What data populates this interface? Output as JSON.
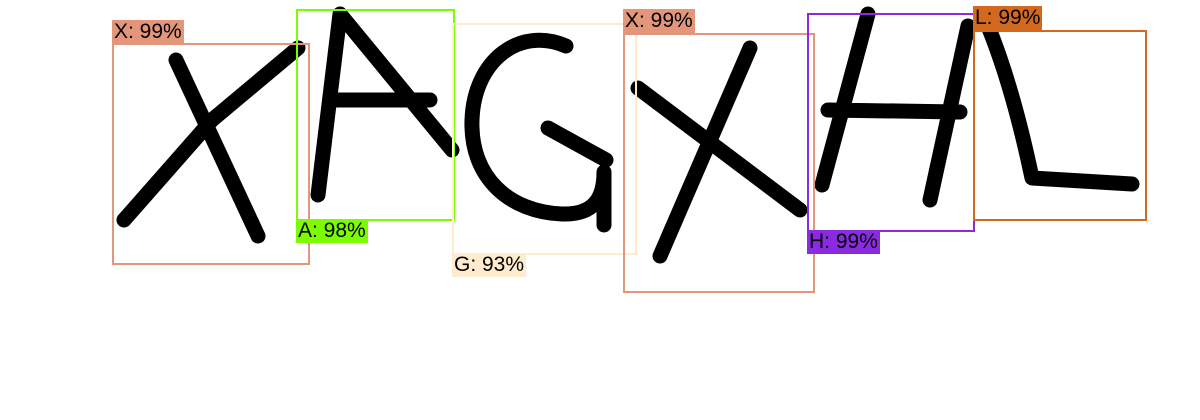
{
  "detections": [
    {
      "label": "X: 99%",
      "color": "#e4967a",
      "char": "X"
    },
    {
      "label": "A: 98%",
      "color": "#7cfc00",
      "char": "A"
    },
    {
      "label": "G: 93%",
      "color": "#ffebcd",
      "char": "G"
    },
    {
      "label": "X: 99%",
      "color": "#e4967a",
      "char": "X"
    },
    {
      "label": "H: 99%",
      "color": "#8a2be2",
      "char": "H"
    },
    {
      "label": "L: 99%",
      "color": "#d2691e",
      "char": "L"
    }
  ]
}
